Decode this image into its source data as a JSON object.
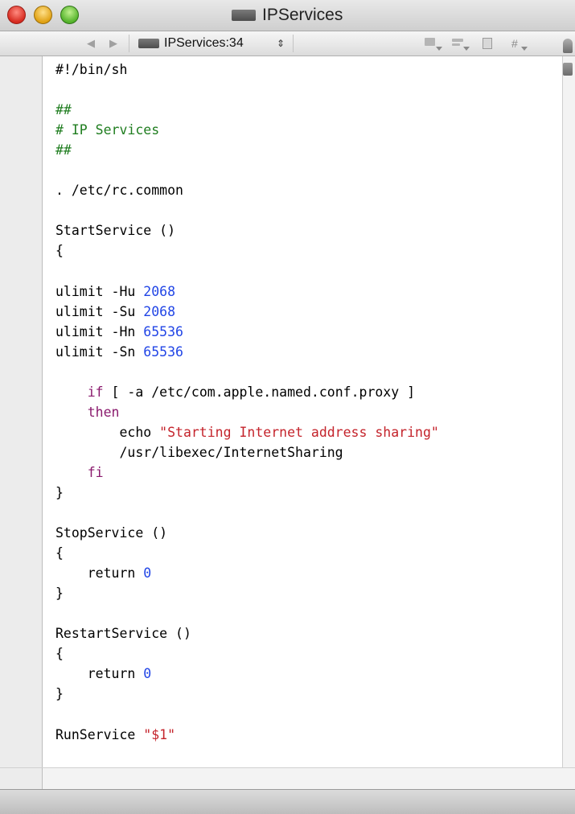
{
  "window": {
    "title": "IPServices"
  },
  "navbar": {
    "file_popup_label": "IPServices:34",
    "popup_arrows": "⇕",
    "back_icon": "◀",
    "forward_icon": "▶",
    "counterpart_label": "#"
  },
  "colors": {
    "comment": "#1f7d1f",
    "number": "#2145e6",
    "keyword": "#8a1a6d",
    "string": "#c4232b"
  },
  "code": {
    "lines": [
      [
        {
          "t": "#!/bin/sh",
          "c": "plain"
        }
      ],
      [],
      [
        {
          "t": "##",
          "c": "comment"
        }
      ],
      [
        {
          "t": "# IP Services",
          "c": "comment"
        }
      ],
      [
        {
          "t": "##",
          "c": "comment"
        }
      ],
      [],
      [
        {
          "t": ". /etc/rc.common",
          "c": "plain"
        }
      ],
      [],
      [
        {
          "t": "StartService ()",
          "c": "plain"
        }
      ],
      [
        {
          "t": "{",
          "c": "plain"
        }
      ],
      [],
      [
        {
          "t": "ulimit -Hu ",
          "c": "plain"
        },
        {
          "t": "2068",
          "c": "number"
        }
      ],
      [
        {
          "t": "ulimit -Su ",
          "c": "plain"
        },
        {
          "t": "2068",
          "c": "number"
        }
      ],
      [
        {
          "t": "ulimit -Hn ",
          "c": "plain"
        },
        {
          "t": "65536",
          "c": "number"
        }
      ],
      [
        {
          "t": "ulimit -Sn ",
          "c": "plain"
        },
        {
          "t": "65536",
          "c": "number"
        }
      ],
      [],
      [
        {
          "t": "    ",
          "c": "plain"
        },
        {
          "t": "if",
          "c": "keyword"
        },
        {
          "t": " [ -a /etc/com.apple.named.conf.proxy ]",
          "c": "plain"
        }
      ],
      [
        {
          "t": "    ",
          "c": "plain"
        },
        {
          "t": "then",
          "c": "keyword"
        }
      ],
      [
        {
          "t": "        echo ",
          "c": "plain"
        },
        {
          "t": "\"Starting Internet address sharing\"",
          "c": "string"
        }
      ],
      [
        {
          "t": "        /usr/libexec/InternetSharing",
          "c": "plain"
        }
      ],
      [
        {
          "t": "    ",
          "c": "plain"
        },
        {
          "t": "fi",
          "c": "keyword"
        }
      ],
      [
        {
          "t": "}",
          "c": "plain"
        }
      ],
      [],
      [
        {
          "t": "StopService ()",
          "c": "plain"
        }
      ],
      [
        {
          "t": "{",
          "c": "plain"
        }
      ],
      [
        {
          "t": "    return ",
          "c": "plain"
        },
        {
          "t": "0",
          "c": "number"
        }
      ],
      [
        {
          "t": "}",
          "c": "plain"
        }
      ],
      [],
      [
        {
          "t": "RestartService ()",
          "c": "plain"
        }
      ],
      [
        {
          "t": "{",
          "c": "plain"
        }
      ],
      [
        {
          "t": "    return ",
          "c": "plain"
        },
        {
          "t": "0",
          "c": "number"
        }
      ],
      [
        {
          "t": "}",
          "c": "plain"
        }
      ],
      [],
      [
        {
          "t": "RunService ",
          "c": "plain"
        },
        {
          "t": "\"$1\"",
          "c": "string"
        }
      ]
    ]
  }
}
